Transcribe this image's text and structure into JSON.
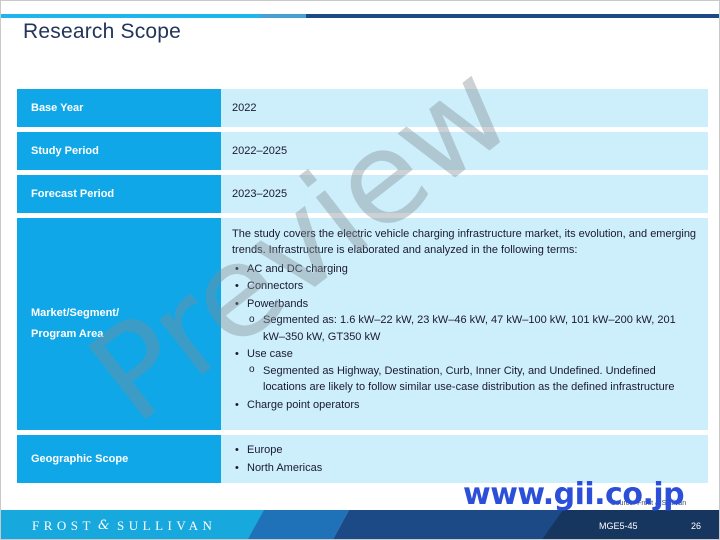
{
  "slide": {
    "title": "Research Scope",
    "colors": {
      "accent_cyan": "#0fa7e8",
      "value_bg": "#cdeefb",
      "title_navy": "#23355b",
      "footer_navy": "#1c4a86",
      "gii_blue": "#2b4fd8"
    }
  },
  "table": {
    "rows": [
      {
        "label": "Base Year",
        "value": "2022"
      },
      {
        "label": "Study Period",
        "value": "2022–2025"
      },
      {
        "label": "Forecast Period",
        "value": "2023–2025"
      }
    ],
    "market_row": {
      "label_line1": "Market/Segment/",
      "label_line2": "Program Area",
      "intro": "The study covers the electric vehicle charging infrastructure market, its evolution, and emerging trends. Infrastructure is elaborated and analyzed in the following terms:",
      "bullets": [
        {
          "text": "AC and DC charging",
          "sub": []
        },
        {
          "text": "Connectors",
          "sub": []
        },
        {
          "text": "Powerbands",
          "sub": [
            "Segmented as: 1.6 kW–22 kW, 23 kW–46 kW, 47 kW–100 kW, 101 kW–200 kW, 201 kW–350 kW, GT350 kW"
          ]
        },
        {
          "text": "Use case",
          "sub": [
            "Segmented as Highway, Destination, Curb, Inner City, and Undefined. Undefined locations are likely to follow similar use-case distribution as the defined infrastructure"
          ]
        },
        {
          "text": "Charge point operators",
          "sub": []
        }
      ],
      "bullet_glyph": "•",
      "subbullet_glyph": "o"
    },
    "geographic_row": {
      "label": "Geographic Scope",
      "items": [
        "Europe",
        "North Americas"
      ],
      "bullet_glyph": "•"
    }
  },
  "watermarks": {
    "preview": "Preview",
    "site": "www.gii.co.jp"
  },
  "source_note": "Source: Frost & Sullivan",
  "footer": {
    "brand_first": "FROST",
    "brand_amp": "&",
    "brand_last": "SULLIVAN",
    "doc_code": "MGE5-45",
    "page_number": "26"
  }
}
